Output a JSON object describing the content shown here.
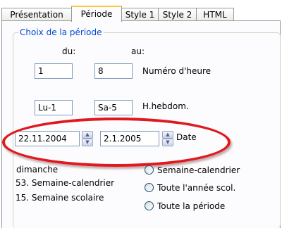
{
  "tabs": [
    {
      "label": "Présentation"
    },
    {
      "label": "Période"
    },
    {
      "label": "Style 1"
    },
    {
      "label": "Style 2"
    },
    {
      "label": "HTML"
    }
  ],
  "active_tab": "Période",
  "group_title": "Choix de la période",
  "headers": {
    "from": "du:",
    "to": "au:"
  },
  "hour_row": {
    "from": "1",
    "to": "8",
    "label": "Numéro d'heure"
  },
  "weekly_row": {
    "from": "Lu-1",
    "to": "Sa-5",
    "label": "H.hebdom."
  },
  "date_row": {
    "from": "22.11.2004",
    "to": "2.1.2005",
    "label": "Date"
  },
  "info": {
    "line1": "dimanche",
    "line2": "53. Semaine-calendrier",
    "line3": "15. Semaine scolaire"
  },
  "options": [
    {
      "label": "Semaine-calendrier"
    },
    {
      "label": "Toute l'année scol."
    },
    {
      "label": "Toute la période"
    }
  ],
  "colors": {
    "highlight_ellipse": "#e0191e",
    "group_title": "#0046d5"
  }
}
